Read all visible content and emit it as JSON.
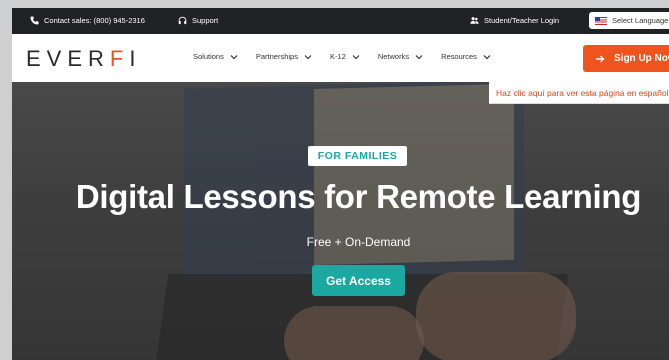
{
  "utility_bar": {
    "contact_label": "Contact sales: (800) 945-2316",
    "support_label": "Support",
    "login_label": "Student/Teacher Login",
    "language_label": "Select Language"
  },
  "header": {
    "logo_text_before": "EVER",
    "logo_f": "F",
    "logo_text_after": "I",
    "menu": [
      {
        "label": "Solutions"
      },
      {
        "label": "Partnerships"
      },
      {
        "label": "K-12"
      },
      {
        "label": "Networks"
      },
      {
        "label": "Resources"
      }
    ],
    "signup_label": "Sign Up Now"
  },
  "banner": {
    "spanish_text": "Haz clic aquí para ver esta página en español"
  },
  "hero": {
    "badge": "FOR FAMILIES",
    "title": "Digital Lessons for Remote Learning",
    "subtitle": "Free + On-Demand",
    "cta_label": "Get Access"
  },
  "colors": {
    "brand_orange": "#f0541e",
    "brand_teal": "#1aa8a0",
    "utility_bg": "#1f2326"
  }
}
